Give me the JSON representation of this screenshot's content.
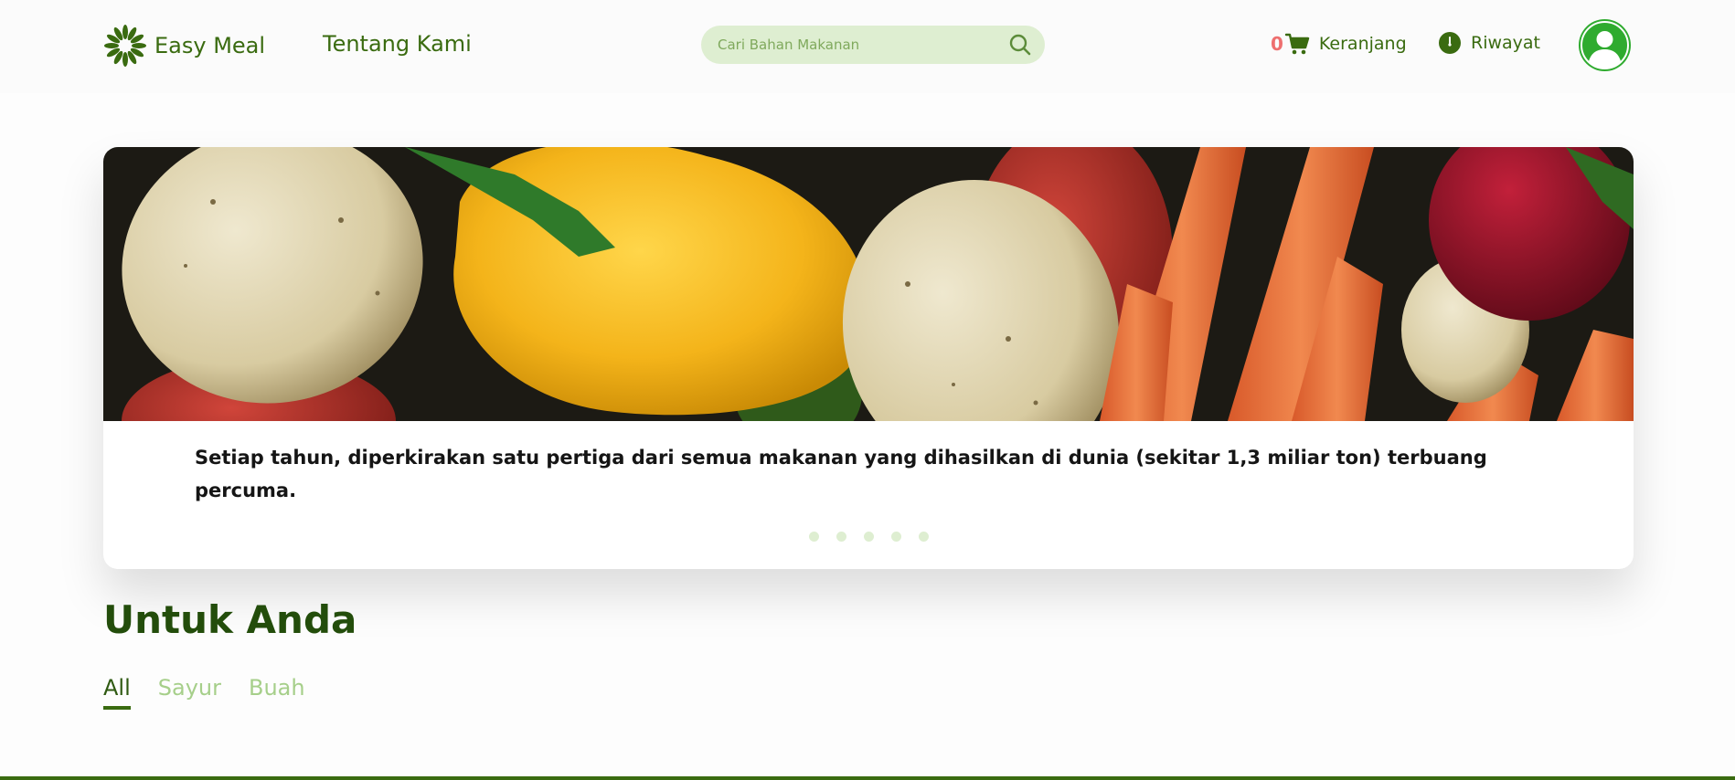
{
  "header": {
    "brand": "Easy Meal",
    "about_link": "Tentang Kami",
    "search": {
      "placeholder": "Cari Bahan Makanan",
      "value": ""
    },
    "cart": {
      "count": "0",
      "label": "Keranjang"
    },
    "history": {
      "label": "Riwayat"
    }
  },
  "hero": {
    "caption": "Setiap tahun, diperkirakan satu pertiga dari semua makanan yang dihasilkan di dunia (sekitar 1,3 miliar ton) terbuang percuma.",
    "slides": 5,
    "active_slide": 1,
    "image_icon": "vegetables-photo"
  },
  "section": {
    "title": "Untuk Anda",
    "filters": [
      "All",
      "Sayur",
      "Buah"
    ],
    "active_filter": "All"
  },
  "colors": {
    "primary": "#3a6b10",
    "primary_dark": "#234d0b",
    "light_green": "#deeed1",
    "cart_count": "#ee6f6f",
    "avatar_bg": "#2fab2f"
  },
  "icons": [
    "logo-sun-icon",
    "search-icon",
    "cart-icon",
    "clock-icon",
    "user-icon"
  ]
}
